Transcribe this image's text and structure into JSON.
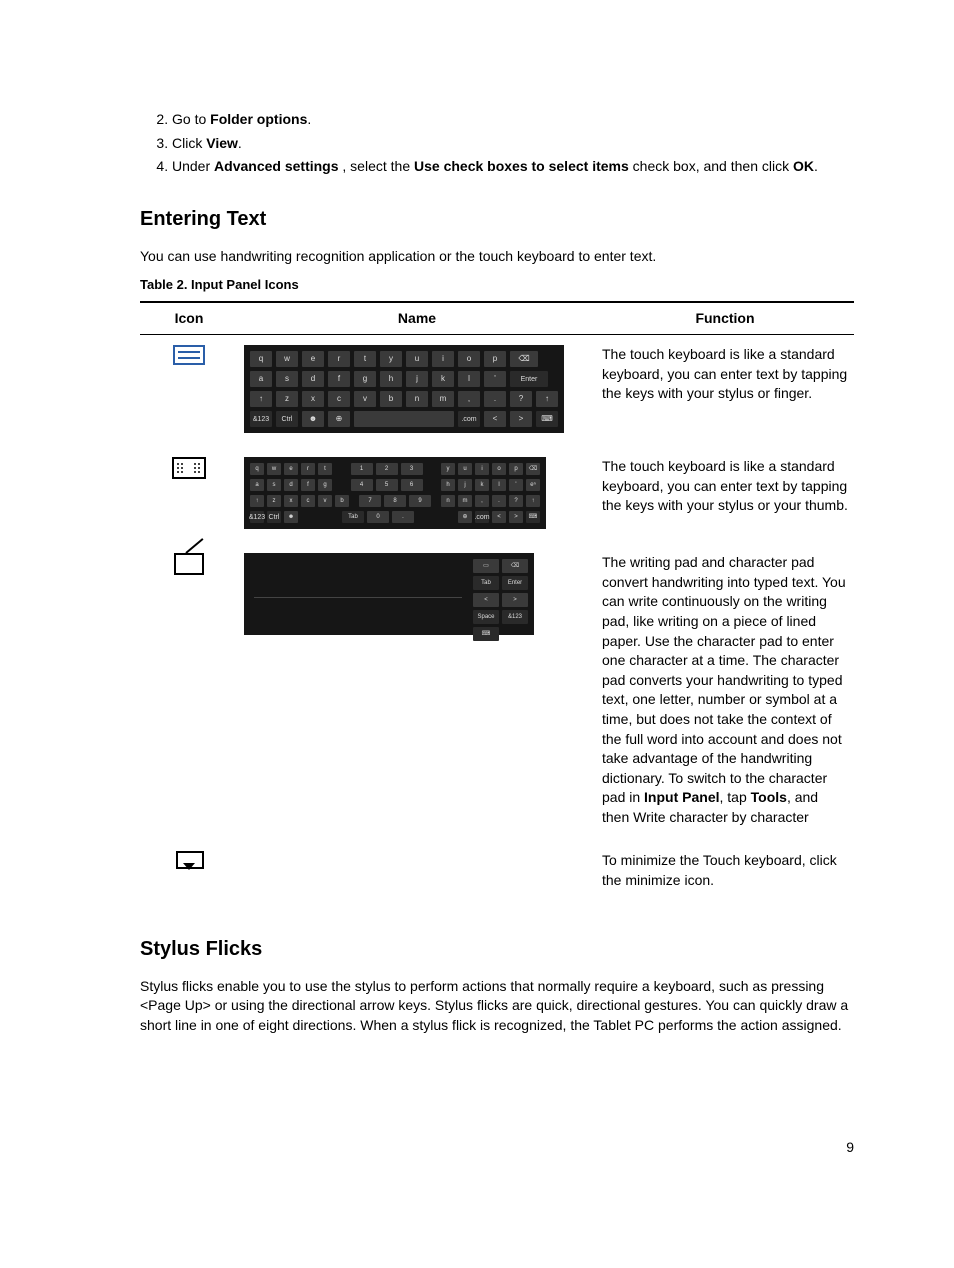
{
  "steps": {
    "s2": {
      "pre": "Go to ",
      "bold": "Folder options",
      "post": "."
    },
    "s3": {
      "pre": "Click ",
      "bold": "View",
      "post": "."
    },
    "s4": {
      "pre": "Under ",
      "bold1": "Advanced settings",
      "mid1": " , select the ",
      "bold2": "Use check boxes to select items",
      "mid2": " check box, and then click ",
      "bold3": "OK",
      "post": "."
    }
  },
  "section1": {
    "title": "Entering Text",
    "lead": "You can use handwriting recognition application or the touch keyboard to enter text.",
    "tableCaption": "Table 2. Input Panel Icons",
    "headers": {
      "icon": "Icon",
      "name": "Name",
      "func": "Function"
    }
  },
  "kbd_std": {
    "r1": [
      "q",
      "w",
      "e",
      "r",
      "t",
      "y",
      "u",
      "i",
      "o",
      "p",
      "⌫"
    ],
    "r2": [
      "a",
      "s",
      "d",
      "f",
      "g",
      "h",
      "j",
      "k",
      "l",
      "'",
      "Enter"
    ],
    "r3": [
      "↑",
      "z",
      "x",
      "c",
      "v",
      "b",
      "n",
      "m",
      ",",
      ".",
      "?",
      "↑"
    ],
    "r4": [
      "&123",
      "Ctrl",
      "☻",
      "⊕",
      "",
      ".com",
      "<",
      ">",
      "⌨"
    ]
  },
  "kbd_split": {
    "r1L": [
      "q",
      "w",
      "e",
      "r",
      "t"
    ],
    "r1M": [
      "1",
      "2",
      "3"
    ],
    "r1R": [
      "y",
      "u",
      "i",
      "o",
      "p",
      "⌫"
    ],
    "r2L": [
      "a",
      "s",
      "d",
      "f",
      "g"
    ],
    "r2M": [
      "4",
      "5",
      "6"
    ],
    "r2R": [
      "h",
      "j",
      "k",
      "l",
      "'",
      "eⁿ"
    ],
    "r3L": [
      "↑",
      "z",
      "x",
      "c",
      "v",
      "b"
    ],
    "r3M": [
      "7",
      "8",
      "9"
    ],
    "r3R": [
      "n",
      "m",
      ",",
      ".",
      "?",
      "↑"
    ],
    "r4L": [
      "&123",
      "Ctrl",
      "☻"
    ],
    "r4M": [
      "Tab",
      "0",
      "."
    ],
    "r4R": [
      "⊕",
      ".com",
      "<",
      ">",
      "⌨"
    ]
  },
  "kbd_write": {
    "side": [
      "▭",
      "⌫",
      "Tab",
      "Enter",
      "<",
      ">",
      "Space",
      "&123",
      "⌨"
    ]
  },
  "rows": {
    "r1_func": "The touch keyboard is like a standard keyboard, you can enter text by tapping the keys with your stylus or finger.",
    "r2_func": "The touch keyboard is like a standard keyboard, you can enter text by tapping the keys with your stylus or your thumb.",
    "r3": {
      "p1": "The writing pad and character pad convert handwriting into typed text. You can write continuously on the writing pad, like writing on a piece of lined paper. Use the character pad to enter one character at a time. The character pad converts your handwriting to typed text, one letter, number or symbol at a time, but does not take the context of the full word into account and does not take advantage of the handwriting dictionary. To switch to the character pad in ",
      "b1": "Input Panel",
      "p2": ", tap ",
      "b2": "Tools",
      "p3": ", and then Write character by character"
    },
    "r4_func": "To minimize the Touch keyboard, click the minimize icon."
  },
  "section2": {
    "title": "Stylus Flicks",
    "para": "Stylus flicks enable you to use the stylus to perform actions that normally require a keyboard, such as pressing <Page Up> or using the directional arrow keys. Stylus flicks are quick, directional gestures. You can quickly draw a short line in one of eight directions. When a stylus flick is recognized, the Tablet PC performs the action assigned."
  },
  "pageNumber": "9"
}
